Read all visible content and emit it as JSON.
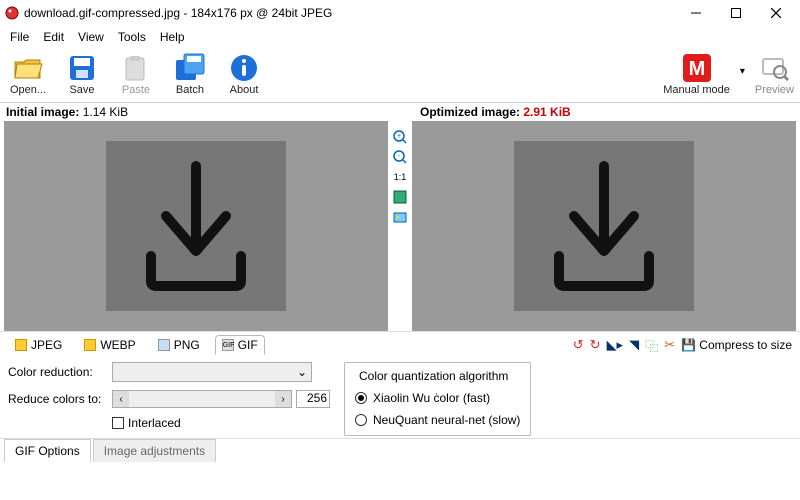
{
  "title_bar": "download.gif-compressed.jpg - 184x176 px @ 24bit JPEG",
  "menu": {
    "file": "File",
    "edit": "Edit",
    "view": "View",
    "tools": "Tools",
    "help": "Help"
  },
  "toolbar": {
    "open": "Open...",
    "save": "Save",
    "paste": "Paste",
    "batch": "Batch",
    "about": "About",
    "manual_mode": "Manual mode",
    "manual_mode_icon_text": "M",
    "preview": "Preview"
  },
  "panels": {
    "initial_label": "Initial image:",
    "initial_size": "1.14 KiB",
    "optimized_label": "Optimized image:",
    "optimized_size": "2.91 KiB"
  },
  "zoom_strip": {
    "ratio": "1:1"
  },
  "format_tabs": {
    "jpeg": "JPEG",
    "webp": "WEBP",
    "png": "PNG",
    "gif": "GIF"
  },
  "side_actions": {
    "compress": "Compress to size"
  },
  "options": {
    "color_reduction_label": "Color reduction:",
    "reduce_colors_label": "Reduce colors to:",
    "reduce_colors_value": "256",
    "interlaced_label": "Interlaced",
    "quant_legend": "Color quantization algorithm",
    "quant_xiaolin": "Xiaolin Wu ċolor (fast)",
    "quant_neuquant": "NeuQuant neural-net (slow)"
  },
  "bottom_tabs": {
    "gif_options": "GIF Options",
    "image_adjustments": "Image adjustments"
  }
}
